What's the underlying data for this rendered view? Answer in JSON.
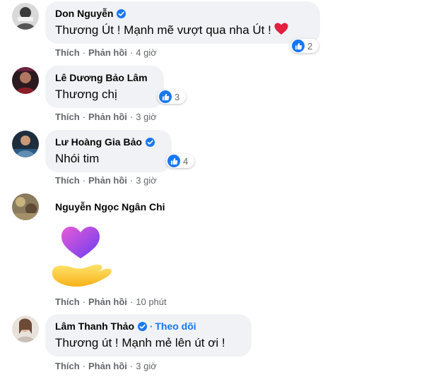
{
  "comments": [
    {
      "author": "Don Nguyễn",
      "verified": true,
      "text": "Thương Út ! Mạnh mẽ vượt qua nha Út !",
      "inline_emoji": "heart-icon",
      "reaction_count": "2",
      "like_label": "Thích",
      "reply_label": "Phản hồi",
      "time": "4 giờ"
    },
    {
      "author": "Lê Dương Bảo Lâm",
      "verified": false,
      "text": "Thương chị",
      "reaction_count": "3",
      "like_label": "Thích",
      "reply_label": "Phản hồi",
      "time": "3 giờ"
    },
    {
      "author": "Lư Hoàng Gia Bảo",
      "verified": true,
      "text": "Nhói tim",
      "reaction_count": "4",
      "like_label": "Thích",
      "reply_label": "Phản hồi",
      "time": "3 giờ"
    },
    {
      "author": "Nguyễn Ngọc Ngân Chi",
      "verified": false,
      "sticker": "heart-in-hand-sticker",
      "like_label": "Thích",
      "reply_label": "Phản hồi",
      "time": "10 phút"
    },
    {
      "author": "Lâm Thanh Thảo",
      "verified": true,
      "follow_label": "Theo dõi",
      "text": "Thương út ! Mạnh mẻ lên út ơi !",
      "like_label": "Thích",
      "reply_label": "Phản hồi",
      "time": "3 giờ"
    }
  ],
  "separator": "·",
  "colors": {
    "bubble": "#f0f2f5",
    "accent": "#1877f2",
    "secondary_text": "#65676b",
    "heart": "#e41e3f"
  }
}
